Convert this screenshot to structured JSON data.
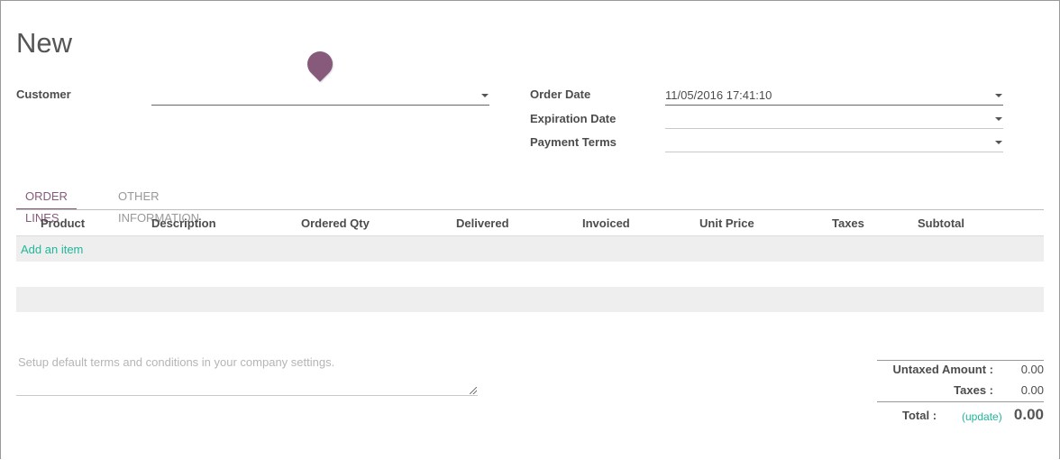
{
  "form": {
    "title": "New",
    "customer": {
      "label": "Customer",
      "value": ""
    },
    "order_date": {
      "label": "Order Date",
      "value": "11/05/2016 17:41:10"
    },
    "expiration_date": {
      "label": "Expiration Date",
      "value": ""
    },
    "payment_terms": {
      "label": "Payment Terms",
      "value": ""
    }
  },
  "tabs": [
    {
      "label": "ORDER LINES",
      "active": true
    },
    {
      "label": "OTHER INFORMATION",
      "active": false
    }
  ],
  "table": {
    "columns": [
      "Product",
      "Description",
      "Ordered Qty",
      "Delivered",
      "Invoiced",
      "Unit Price",
      "Taxes",
      "Subtotal"
    ],
    "add_item": "Add an item"
  },
  "notes": {
    "placeholder": "Setup default terms and conditions in your company settings."
  },
  "totals": {
    "untaxed_label": "Untaxed Amount :",
    "untaxed_value": "0.00",
    "taxes_label": "Taxes :",
    "taxes_value": "0.00",
    "total_label": "Total :",
    "update_label": "(update)",
    "total_value": "0.00"
  },
  "colors": {
    "accent": "#875a7b",
    "link": "#21b799"
  }
}
